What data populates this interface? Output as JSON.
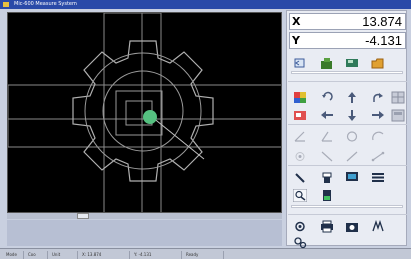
{
  "window": {
    "title": "Mic-600 Measure System"
  },
  "dro": {
    "x_label": "X",
    "x_value": "13.874",
    "y_label": "Y",
    "y_value": "-4.131"
  },
  "statusbar": {
    "cells": [
      "Mode",
      "Coo",
      "Unit",
      "X: 13.874",
      "Y: -4.131",
      "Ready"
    ]
  },
  "icons": {
    "row1": [
      "back-icon",
      "open-icon",
      "save-icon",
      "folder-icon"
    ],
    "row2": [
      "color-icon",
      "rotate-icon",
      "arrow-up-icon",
      "redo-icon",
      "grid-icon"
    ],
    "row3": [
      "image-icon",
      "arrow-left-icon",
      "arrow-down-icon",
      "arrow-right-icon",
      "panel-icon"
    ],
    "row4": [
      "angle-icon",
      "angle2-icon",
      "circle-icon",
      "arc-icon"
    ],
    "row5": [
      "point-icon",
      "line-icon",
      "tangent-icon",
      "distance-icon"
    ],
    "row6": [
      "pen-icon",
      "lamp-icon",
      "monitor-icon",
      "list-icon"
    ],
    "row7": [
      "zoom-icon",
      "edge-icon"
    ],
    "row8": [
      "settings-icon",
      "print-icon",
      "camera-icon",
      "measure-icon"
    ],
    "row9": [
      "help-icon"
    ]
  },
  "colors": {
    "viewport_bg": "#000000",
    "overlay": "#9a9a9a",
    "marker": "#55c080",
    "accent": "#2a4aa8"
  }
}
